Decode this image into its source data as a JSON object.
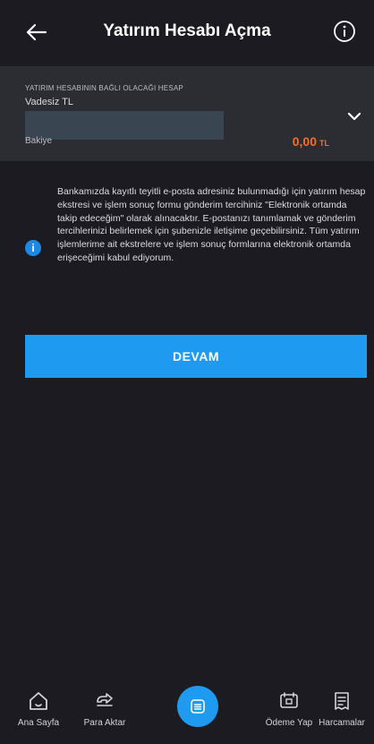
{
  "header": {
    "title": "Yatırım Hesabı Açma"
  },
  "account": {
    "label": "YATIRIM HESABININ BAĞLI OLACAĞI HESAP",
    "name": "Vadesiz TL",
    "balance_label": "Bakiye",
    "balance_value": "0,00",
    "balance_currency": "TL"
  },
  "notice": {
    "text": "Bankamızda kayıtlı teyitli e-posta adresiniz bulunmadığı için yatırım hesap ekstresi ve işlem sonuç formu gönderim tercihiniz \"Elektronik ortamda takip edeceğim\" olarak alınacaktır. E-postanızı tanımlamak ve gönderim tercihlerinizi belirlemek için şubenizle iletişime geçebilirsiniz. Tüm yatırım işlemlerime ait ekstrelere ve işlem sonuç formlarına elektronik ortamda erişeceğimi kabul ediyorum."
  },
  "actions": {
    "continue_label": "DEVAM"
  },
  "bottom_nav": {
    "items": [
      {
        "label": "Ana Sayfa",
        "icon": "home-icon"
      },
      {
        "label": "Para Aktar",
        "icon": "money-transfer-icon"
      },
      {
        "label": "Ödeme Yap",
        "icon": "payment-icon"
      },
      {
        "label": "Harcamalar",
        "icon": "receipt-icon"
      }
    ],
    "center_icon": "menu-icon"
  },
  "colors": {
    "background": "#1b1b21",
    "card": "#2c2c33",
    "accent": "#1e9bf0",
    "balance": "#f26f2a"
  }
}
